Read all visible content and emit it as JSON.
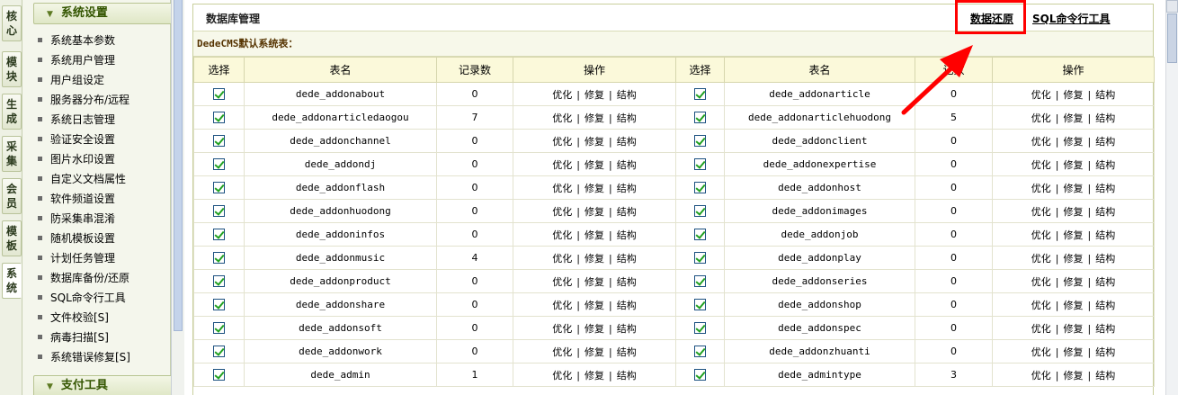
{
  "vtabs": [
    {
      "chars": [
        "核",
        "心"
      ]
    },
    {
      "chars": [
        "模",
        "块"
      ]
    },
    {
      "chars": [
        "生",
        "成"
      ]
    },
    {
      "chars": [
        "采",
        "集"
      ]
    },
    {
      "chars": [
        "会",
        "员"
      ]
    },
    {
      "chars": [
        "模",
        "板"
      ]
    },
    {
      "chars": [
        "系",
        "统"
      ]
    }
  ],
  "leftmenu": {
    "header": "系统设置",
    "items": [
      {
        "label": "系统基本参数"
      },
      {
        "label": "系统用户管理"
      },
      {
        "label": "用户组设定"
      },
      {
        "label": "服务器分布/远程"
      },
      {
        "label": "系统日志管理"
      },
      {
        "label": "验证安全设置"
      },
      {
        "label": "图片水印设置"
      },
      {
        "label": "自定义文档属性"
      },
      {
        "label": "软件频道设置"
      },
      {
        "label": "防采集串混淆"
      },
      {
        "label": "随机模板设置"
      },
      {
        "label": "计划任务管理"
      },
      {
        "label": "数据库备份/还原"
      },
      {
        "label": "SQL命令行工具"
      },
      {
        "label": "文件校验[S]"
      },
      {
        "label": "病毒扫描[S]"
      },
      {
        "label": "系统错误修复[S]"
      }
    ],
    "header2": "支付工具"
  },
  "main": {
    "title": "数据库管理",
    "restore_link": "数据还原",
    "sql_link": "SQL命令行工具",
    "section_label": "DedeCMS默认系统表：",
    "columns": [
      "选择",
      "表名",
      "记录数",
      "操作",
      "选择",
      "表名",
      "记数",
      "操作"
    ],
    "op_labels": {
      "optimize": "优化",
      "repair": "修复",
      "structure": "结构",
      "sep": "|"
    },
    "rows": [
      {
        "left": {
          "name": "dede_addonabout",
          "count": "0"
        },
        "right": {
          "name": "dede_addonarticle",
          "count": "0"
        }
      },
      {
        "left": {
          "name": "dede_addonarticledaogou",
          "count": "7"
        },
        "right": {
          "name": "dede_addonarticlehuodong",
          "count": "5"
        }
      },
      {
        "left": {
          "name": "dede_addonchannel",
          "count": "0"
        },
        "right": {
          "name": "dede_addonclient",
          "count": "0"
        }
      },
      {
        "left": {
          "name": "dede_addondj",
          "count": "0"
        },
        "right": {
          "name": "dede_addonexpertise",
          "count": "0"
        }
      },
      {
        "left": {
          "name": "dede_addonflash",
          "count": "0"
        },
        "right": {
          "name": "dede_addonhost",
          "count": "0"
        }
      },
      {
        "left": {
          "name": "dede_addonhuodong",
          "count": "0"
        },
        "right": {
          "name": "dede_addonimages",
          "count": "0"
        }
      },
      {
        "left": {
          "name": "dede_addoninfos",
          "count": "0"
        },
        "right": {
          "name": "dede_addonjob",
          "count": "0"
        }
      },
      {
        "left": {
          "name": "dede_addonmusic",
          "count": "4"
        },
        "right": {
          "name": "dede_addonplay",
          "count": "0"
        }
      },
      {
        "left": {
          "name": "dede_addonproduct",
          "count": "0"
        },
        "right": {
          "name": "dede_addonseries",
          "count": "0"
        }
      },
      {
        "left": {
          "name": "dede_addonshare",
          "count": "0"
        },
        "right": {
          "name": "dede_addonshop",
          "count": "0"
        }
      },
      {
        "left": {
          "name": "dede_addonsoft",
          "count": "0"
        },
        "right": {
          "name": "dede_addonspec",
          "count": "0"
        }
      },
      {
        "left": {
          "name": "dede_addonwork",
          "count": "0"
        },
        "right": {
          "name": "dede_addonzhuanti",
          "count": "0"
        }
      },
      {
        "left": {
          "name": "dede_admin",
          "count": "1"
        },
        "right": {
          "name": "dede_admintype",
          "count": "3"
        }
      }
    ]
  },
  "colors": {
    "highlight": "#ff0000",
    "arrow": "#ff0000",
    "checkmark": "#21a121",
    "header_bg": "#fbf9da"
  }
}
